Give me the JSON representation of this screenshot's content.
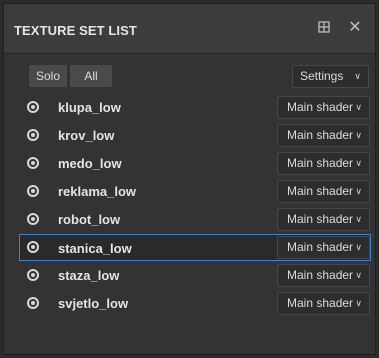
{
  "panel": {
    "title": "TEXTURE SET LIST",
    "dock_icon": "dock-panel-icon",
    "close_icon": "close-icon"
  },
  "toolbar": {
    "solo_label": "Solo",
    "all_label": "All",
    "settings_label": "Settings",
    "settings_icon": "chevron-down-icon"
  },
  "texture_sets": [
    {
      "name": "klupa_low",
      "shader": "Main shader",
      "selected": false
    },
    {
      "name": "krov_low",
      "shader": "Main shader",
      "selected": false
    },
    {
      "name": "medo_low",
      "shader": "Main shader",
      "selected": false
    },
    {
      "name": "reklama_low",
      "shader": "Main shader",
      "selected": false
    },
    {
      "name": "robot_low",
      "shader": "Main shader",
      "selected": false
    },
    {
      "name": "stanica_low",
      "shader": "Main shader",
      "selected": true
    },
    {
      "name": "staza_low",
      "shader": "Main shader",
      "selected": false
    },
    {
      "name": "svjetlo_low",
      "shader": "Main shader",
      "selected": false
    }
  ],
  "colors": {
    "selection_border": "#3e7fd0"
  }
}
